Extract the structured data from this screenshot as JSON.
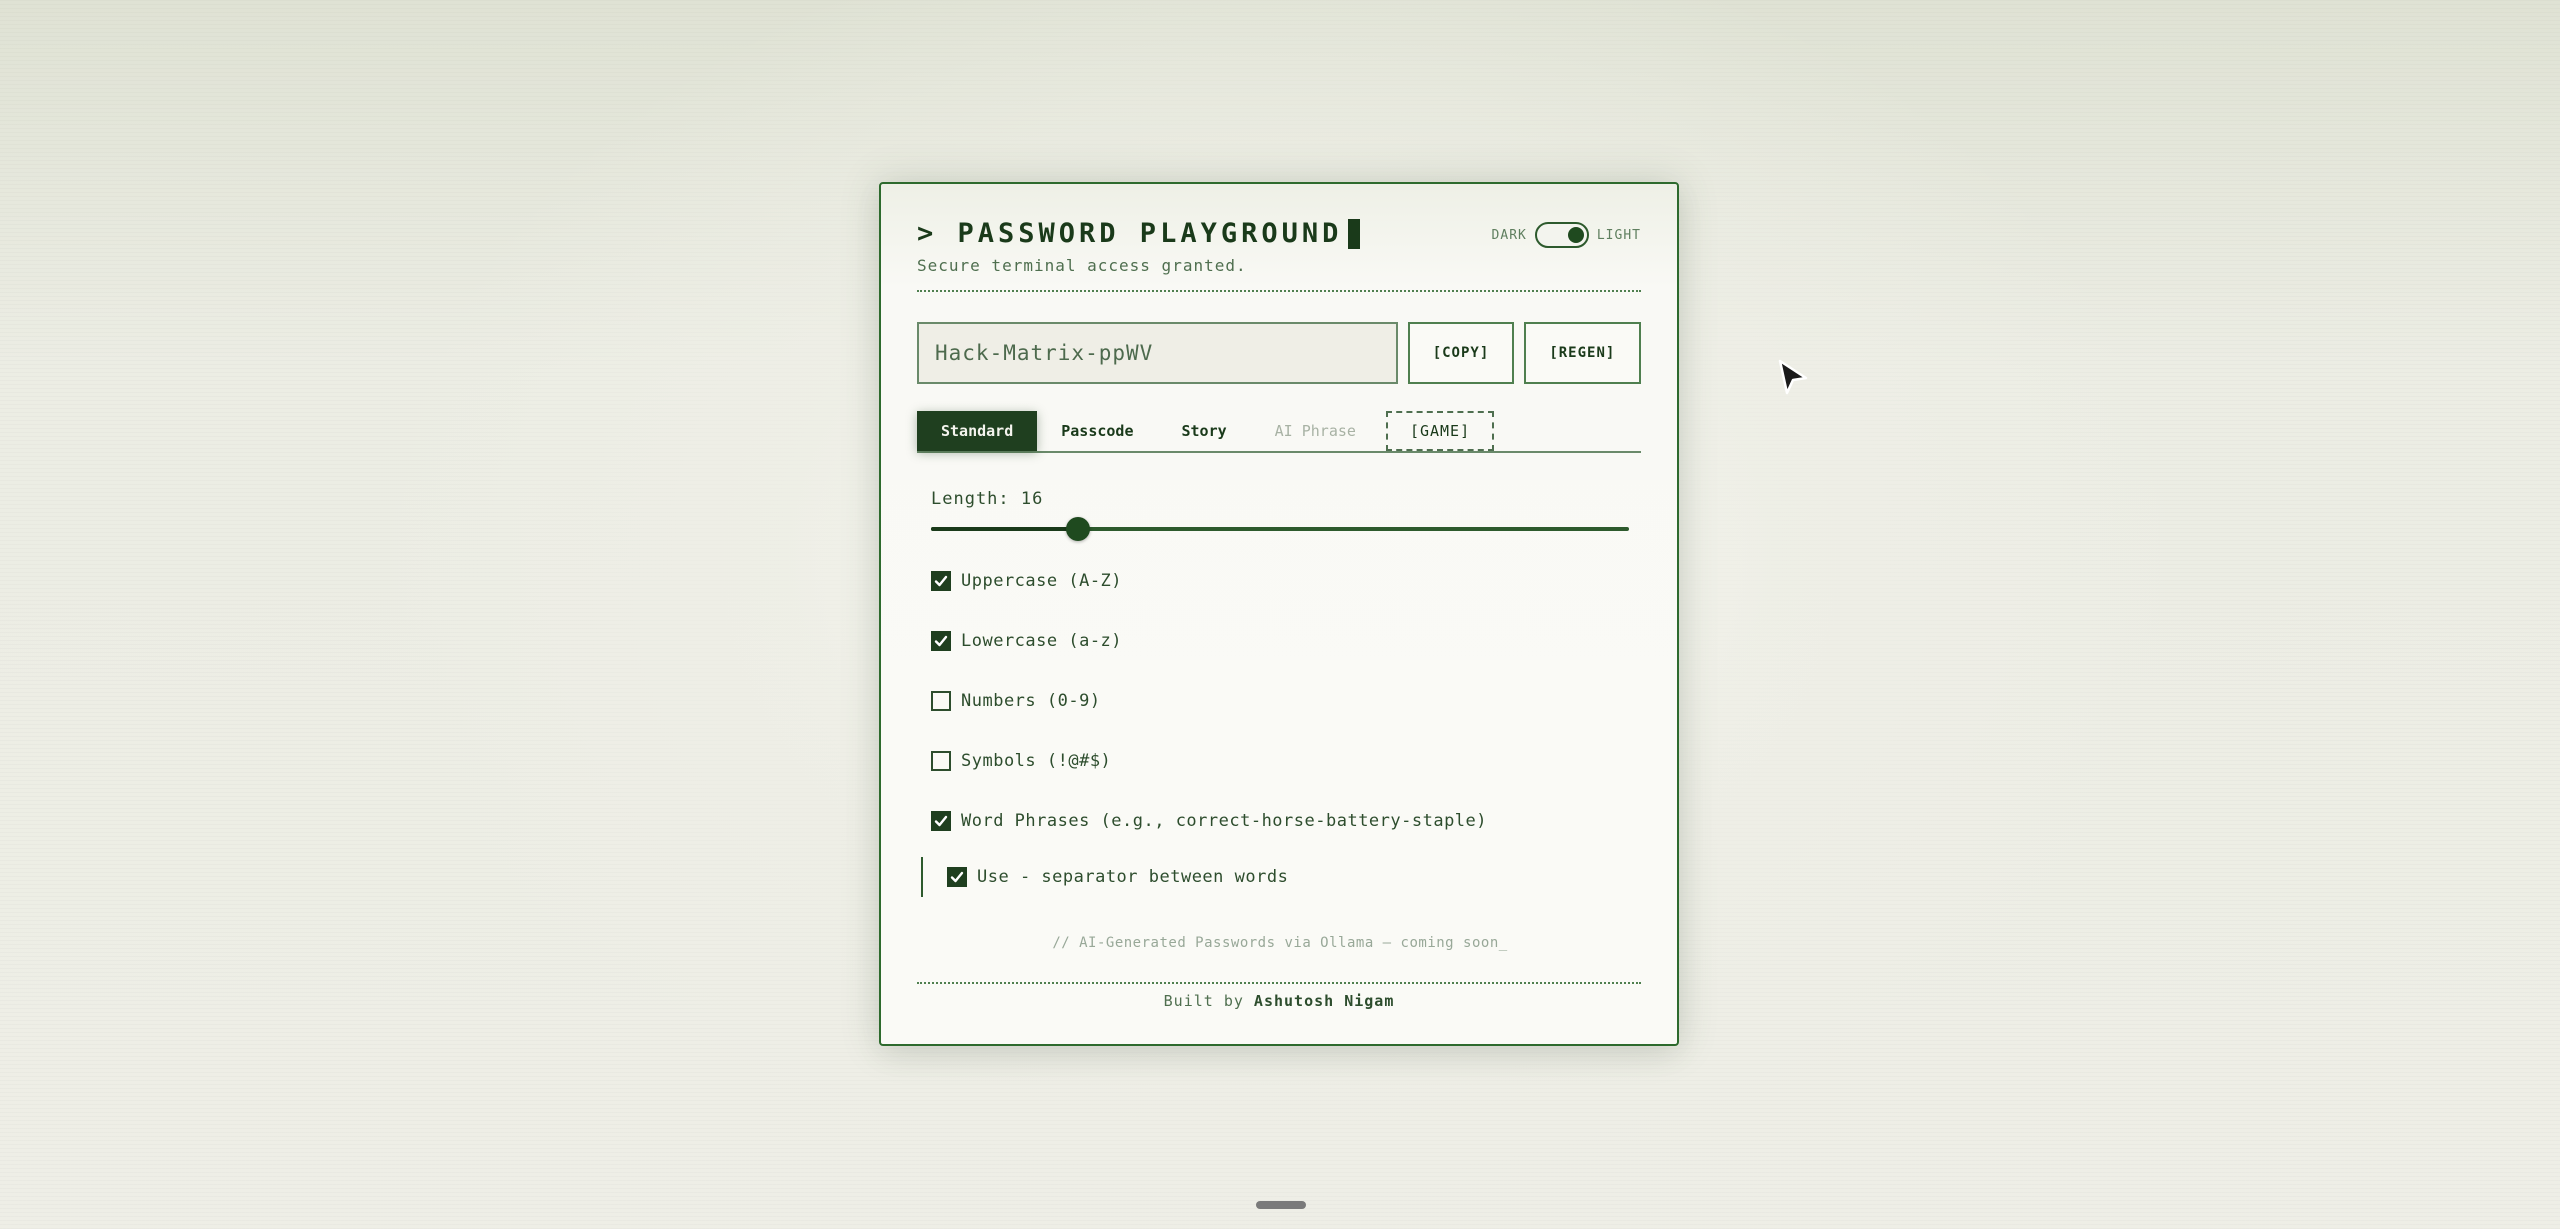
{
  "header": {
    "title": "> PASSWORD PLAYGROUND",
    "subtitle": "Secure terminal access granted.",
    "theme": {
      "dark_label": "DARK",
      "light_label": "LIGHT",
      "mode": "light"
    }
  },
  "password": {
    "value": "Hack-Matrix-ppWV",
    "copy_label": "[COPY]",
    "regen_label": "[REGEN]"
  },
  "tabs": [
    {
      "label": "Standard",
      "state": "active"
    },
    {
      "label": "Passcode",
      "state": "normal"
    },
    {
      "label": "Story",
      "state": "normal"
    },
    {
      "label": "AI Phrase",
      "state": "disabled"
    },
    {
      "label": "[GAME]",
      "state": "normal"
    }
  ],
  "settings": {
    "length_label": "Length:",
    "length_value": "16",
    "length_fraction": 0.21,
    "options": [
      {
        "label": "Uppercase (A-Z)",
        "checked": true
      },
      {
        "label": "Lowercase (a-z)",
        "checked": true
      },
      {
        "label": "Numbers (0-9)",
        "checked": false
      },
      {
        "label": "Symbols (!@#$)",
        "checked": false
      },
      {
        "label": "Word Phrases (e.g., correct-horse-battery-staple)",
        "checked": true
      }
    ],
    "separator_option": {
      "label": "Use - separator between words",
      "checked": true
    }
  },
  "note": "// AI-Generated Passwords via Ollama — coming soon_",
  "footer": {
    "built_by": "Built by",
    "author": "Ashutosh Nigam"
  },
  "colors": {
    "accent": "#1f3f1f",
    "border": "#2d6a2d",
    "background": "#fafaf6"
  }
}
